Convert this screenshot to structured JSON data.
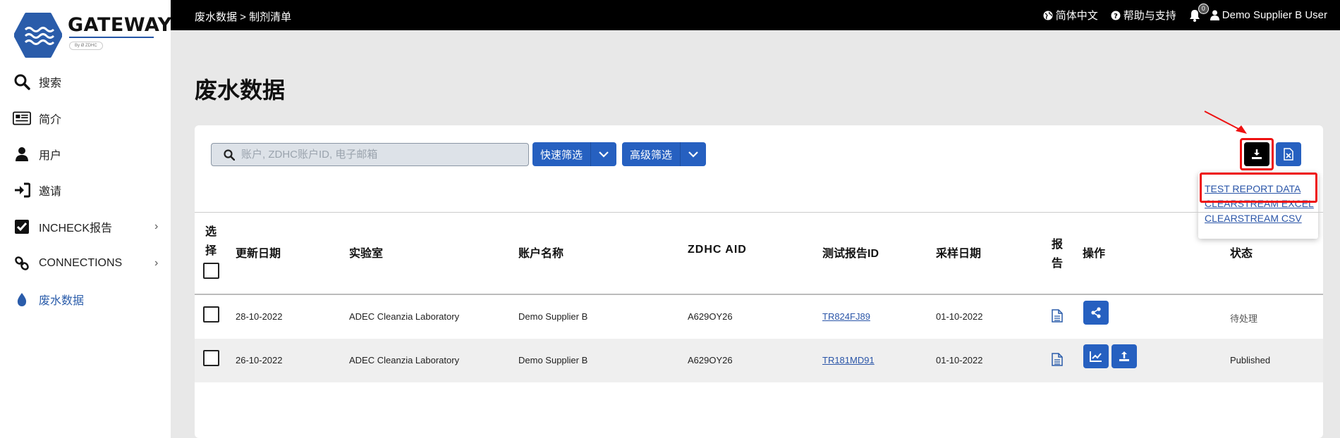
{
  "logo": {
    "word": "GATEWAY",
    "by": "By Ø ZDHC"
  },
  "sidebar": {
    "items": [
      {
        "label": "搜索",
        "icon": "search-icon",
        "chevron": ""
      },
      {
        "label": "简介",
        "icon": "newspaper-icon",
        "chevron": ""
      },
      {
        "label": "用户",
        "icon": "user-icon",
        "chevron": ""
      },
      {
        "label": "邀请",
        "icon": "sign-in-icon",
        "chevron": ""
      },
      {
        "label": "INCHECK报告",
        "icon": "checkbox-icon",
        "chevron": "›"
      },
      {
        "label": "CONNECTIONS",
        "icon": "link-icon",
        "chevron": "›"
      },
      {
        "label": "废水数据",
        "icon": "droplet-icon",
        "chevron": ""
      }
    ],
    "active_index": 6
  },
  "topbar": {
    "breadcrumb": "废水数据 > 制剂清单",
    "language": "简体中文",
    "help": "帮助与支持",
    "notifications_count": "0",
    "user": "Demo Supplier B User"
  },
  "page": {
    "title": "废水数据"
  },
  "toolbar": {
    "search_placeholder": "账户, ZDHC账户ID, 电子邮箱",
    "quick_filter": "快速筛选",
    "advanced_filter": "高级筛选"
  },
  "download_menu": {
    "items": [
      "TEST REPORT DATA",
      "CLEARSTREAM EXCEL",
      "CLEARSTREAM CSV"
    ]
  },
  "table": {
    "headers": {
      "select_1": "选",
      "select_2": "择",
      "updated": "更新日期",
      "lab": "实验室",
      "account": "账户名称",
      "aid": "ZDHC AID",
      "report_id": "测试报告ID",
      "sample_date": "采样日期",
      "report_1": "报",
      "report_2": "告",
      "actions": "操作",
      "status": "状态"
    },
    "rows": [
      {
        "updated": "28-10-2022",
        "lab": "ADEC Cleanzia Laboratory",
        "account": "Demo Supplier B",
        "aid": "A629OY26",
        "report_id": "TR824FJ89",
        "sample_date": "01-10-2022",
        "status": "待处理"
      },
      {
        "updated": "26-10-2022",
        "lab": "ADEC Cleanzia Laboratory",
        "account": "Demo Supplier B",
        "aid": "A629OY26",
        "report_id": "TR181MD91",
        "sample_date": "01-10-2022",
        "status": "Published"
      }
    ]
  },
  "colors": {
    "accent": "#2660c0",
    "topbar": "#000000",
    "highlight": "#ee1111"
  }
}
